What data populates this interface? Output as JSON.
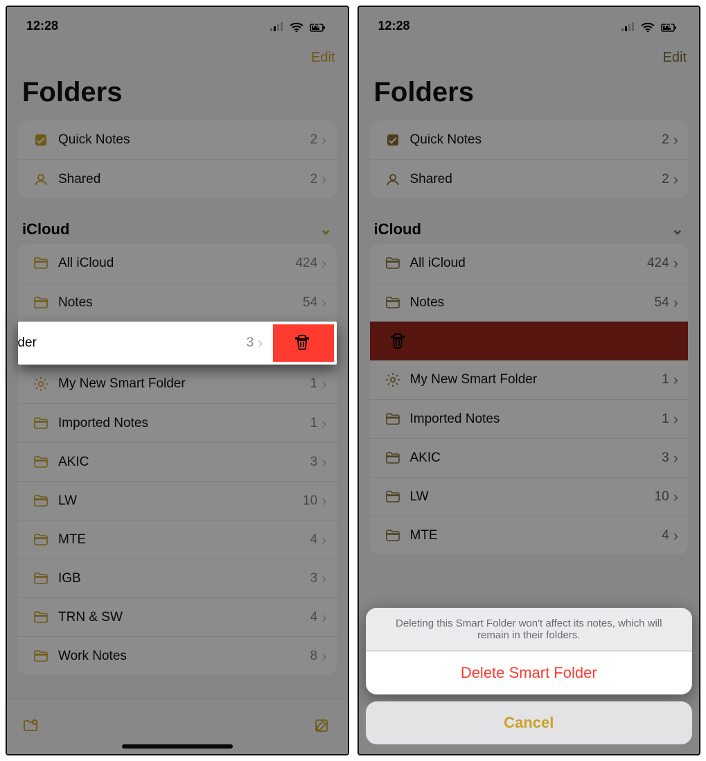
{
  "status": {
    "time": "12:28",
    "battery": "73"
  },
  "nav": {
    "edit": "Edit"
  },
  "title": "Folders",
  "top_group": [
    {
      "icon": "quick-notes-icon",
      "label": "Quick Notes",
      "count": "2"
    },
    {
      "icon": "shared-icon",
      "label": "Shared",
      "count": "2"
    }
  ],
  "section": {
    "name": "iCloud"
  },
  "swiped": {
    "label": "pen Folder",
    "count": "3"
  },
  "folders": [
    {
      "icon": "folder-icon",
      "label": "All iCloud",
      "count": "424"
    },
    {
      "icon": "folder-icon",
      "label": "Notes",
      "count": "54"
    },
    {
      "icon": "gear-icon",
      "label": "My New Smart Folder",
      "count": "1"
    },
    {
      "icon": "folder-icon",
      "label": "Imported Notes",
      "count": "1"
    },
    {
      "icon": "folder-icon",
      "label": "AKIC",
      "count": "3"
    },
    {
      "icon": "folder-icon",
      "label": "LW",
      "count": "10"
    },
    {
      "icon": "folder-icon",
      "label": "MTE",
      "count": "4"
    },
    {
      "icon": "folder-icon",
      "label": "IGB",
      "count": "3"
    },
    {
      "icon": "folder-icon",
      "label": "TRN & SW",
      "count": "4"
    },
    {
      "icon": "folder-icon",
      "label": "Work Notes",
      "count": "8"
    }
  ],
  "folders_right_partial": [
    {
      "icon": "folder-icon",
      "label": "All iCloud",
      "count": "424"
    },
    {
      "icon": "folder-icon",
      "label": "Notes",
      "count": "54"
    },
    {
      "icon": "gear-icon",
      "label": "My New Smart Folder",
      "count": "1"
    },
    {
      "icon": "folder-icon",
      "label": "Imported Notes",
      "count": "1"
    },
    {
      "icon": "folder-icon",
      "label": "AKIC",
      "count": "3"
    },
    {
      "icon": "folder-icon",
      "label": "LW",
      "count": "10"
    },
    {
      "icon": "folder-icon",
      "label": "MTE",
      "count": "4"
    }
  ],
  "sheet": {
    "message": "Deleting this Smart Folder won't affect its notes, which will remain in their folders.",
    "delete": "Delete Smart Folder",
    "cancel": "Cancel"
  }
}
